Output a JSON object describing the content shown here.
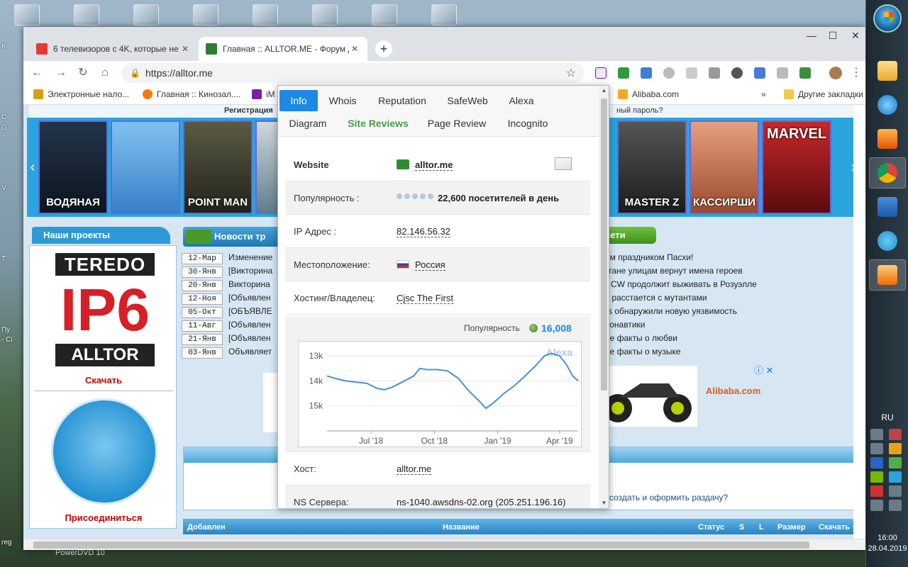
{
  "desktop": {
    "left_labels": [
      "К",
      "С",
      "G",
      "V",
      "Т",
      "Пу",
      "- Ci",
      "reg"
    ],
    "bottom_label": "PowerDVD 10"
  },
  "browser": {
    "tabs": [
      {
        "title": "6 телевизоров с 4K, которые не",
        "active": false,
        "favicon_color": "#e53935"
      },
      {
        "title": "Главная :: ALLTOR.ME - Форум д",
        "active": true,
        "favicon_color": "#2e7d32"
      }
    ],
    "new_tab_glyph": "+",
    "window_controls": {
      "minimize": "—",
      "maximize": "☐",
      "close": "✕"
    },
    "nav": {
      "back": "←",
      "forward": "→",
      "reload": "↻",
      "home": "⌂"
    },
    "address": {
      "lock": "🔒",
      "url": "https://alltor.me",
      "star": "☆"
    },
    "menu_glyph": "⋮",
    "bookmarks": [
      "Электронные нало...",
      "Главная :: Кинозал....",
      "iM",
      "Alibaba.com",
      "»",
      "Другие закладки"
    ]
  },
  "page": {
    "registration_strip": "Регистрация",
    "forgot_password": "ный пароль?",
    "carousel": {
      "prev": "‹",
      "next": "›",
      "posters": [
        {
          "caption": "ВОДЯНАЯ",
          "color": "#1e2a3a"
        },
        {
          "caption": "",
          "color": "#4a8fd4"
        },
        {
          "caption": "POINT MAN",
          "color": "#3b3a2a"
        },
        {
          "caption": "MASTER Z",
          "color": "#2f2f2f"
        },
        {
          "caption": "КАССИРШИ",
          "color": "#b65b3f"
        },
        {
          "caption": "MARVEL",
          "color": "#b31217"
        }
      ]
    },
    "projects": {
      "heading": "Наши проекты",
      "teredo_top": "TEREDO",
      "teredo_mid": "IP6",
      "teredo_bottom": "ALLTOR",
      "download": "Скачать",
      "join": "Присоединиться"
    },
    "news": {
      "heading": "Новости тр",
      "items": [
        {
          "date": "12-Мар",
          "text": "Изменение"
        },
        {
          "date": "30-Янв",
          "text": "[Викторина"
        },
        {
          "date": "20-Янв",
          "text": "Викторина"
        },
        {
          "date": "12-Ноя",
          "text": "[Объявлен"
        },
        {
          "date": "05-Окт",
          "text": "[ОБЪЯВЛЕ"
        },
        {
          "date": "11-Авг",
          "text": "[Объявлен"
        },
        {
          "date": "21-Янв",
          "text": "[Объявлен"
        },
        {
          "date": "03-Янв",
          "text": "Объявляет"
        }
      ]
    },
    "network": {
      "heading": "сети",
      "items": [
        "ым праздником Пасхи!",
        "стане улицам вернут имена героев",
        "е CW продолжит выживать в Розуэлле",
        "X расстается с мутантами",
        "vs обнаружили новую уязвимость",
        "монавтики",
        "ые факты о любви",
        "ые факты о музыке"
      ]
    },
    "ad": {
      "logo": "Alibaba.com",
      "info_close": "ⓘ ✕"
    },
    "section_link": "создать и оформить раздачу?",
    "table_headers": [
      "Добавлен",
      "Название",
      "Статус",
      "S",
      "L",
      "Размер",
      "Скачать"
    ]
  },
  "popup": {
    "tabs_row1": [
      "Info",
      "Whois",
      "Reputation",
      "SafeWeb",
      "Alexa"
    ],
    "tabs_row2": [
      "Diagram",
      "Site Reviews",
      "Page Review",
      "Incognito"
    ],
    "selected_tab": "Info",
    "rows": {
      "website_label": "Website",
      "website_value": "alltor.me",
      "popularity_label": "Популярность :",
      "popularity_value": "22,600 посетителей в день",
      "ip_label": "IP Адрес :",
      "ip_value": "82.146.56.32",
      "location_label": "Местоположение:",
      "location_value": "Россия",
      "hosting_label": "Хостинг/Владелец:",
      "hosting_value": "Cjsc The First",
      "host_label": "Хост:",
      "host_value": "alltor.me",
      "ns_label": "NS Сервера:",
      "ns_value": "ns-1040.awsdns-02.org (205.251.196.16)"
    },
    "chart_header_label": "Популярность",
    "chart_header_value": "16,008"
  },
  "chart_data": {
    "type": "line",
    "title": "",
    "watermark": "Alexa",
    "ylabel": "",
    "xlabel": "",
    "y_inverted": true,
    "ylim": [
      12600,
      16000
    ],
    "yticks": [
      13000,
      14000,
      15000
    ],
    "ytick_labels": [
      "13k",
      "14k",
      "15k"
    ],
    "xlim": [
      "2018-04-28",
      "2019-04-28"
    ],
    "xticks": [
      "2018-07-01",
      "2018-10-01",
      "2019-01-01",
      "2019-04-01"
    ],
    "xtick_labels": [
      "Jul '18",
      "Oct '18",
      "Jan '19",
      "Apr '19"
    ],
    "series": [
      {
        "x": [
          "2018-04-28",
          "2018-05-10",
          "2018-05-25",
          "2018-06-10",
          "2018-06-25",
          "2018-07-10",
          "2018-07-20",
          "2018-08-01",
          "2018-08-15",
          "2018-09-01",
          "2018-09-10",
          "2018-09-20",
          "2018-10-05",
          "2018-10-20",
          "2018-11-05",
          "2018-11-20",
          "2018-12-05",
          "2018-12-15",
          "2018-12-25",
          "2019-01-10",
          "2019-01-25",
          "2019-02-10",
          "2019-02-25",
          "2019-03-10",
          "2019-03-20",
          "2019-04-01",
          "2019-04-10",
          "2019-04-20",
          "2019-04-28"
        ],
        "values": [
          13800,
          13900,
          14000,
          14050,
          14100,
          14300,
          14350,
          14250,
          14050,
          13800,
          13500,
          13550,
          13550,
          13600,
          13900,
          14400,
          14800,
          15100,
          14900,
          14500,
          14200,
          13800,
          13400,
          13000,
          12900,
          13000,
          13300,
          13800,
          14000
        ]
      }
    ],
    "grid": true,
    "line_color": "#4a90d9"
  },
  "taskbar": {
    "language": "RU",
    "time": "16:00",
    "date": "28.04.2019"
  }
}
